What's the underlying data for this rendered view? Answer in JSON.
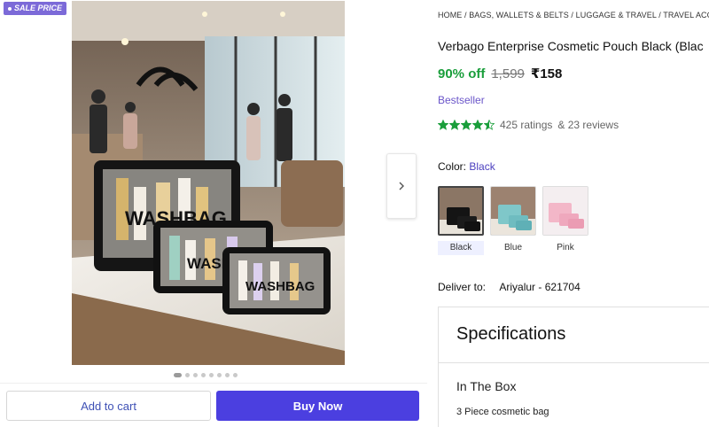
{
  "badge": {
    "label": "SALE PRICE"
  },
  "gallery": {
    "image_text": "WASHBAG",
    "dot_count": 8,
    "active_dot": 0
  },
  "actions": {
    "add_to_cart": "Add to cart",
    "buy_now": "Buy Now"
  },
  "product": {
    "breadcrumb": "HOME / BAGS, WALLETS & BELTS / LUGGAGE & TRAVEL / TRAVEL ACCESSO",
    "title": "Verbago Enterprise Cosmetic Pouch Black (Blac",
    "discount": "90% off",
    "mrp": "1,599",
    "price": "₹158",
    "tag": "Bestseller",
    "rating_value": 4.5,
    "ratings_text": "425 ratings",
    "reviews_text": "& 23 reviews",
    "color_label": "Color:",
    "color_value": "Black",
    "colors": [
      {
        "label": "Black",
        "selected": true
      },
      {
        "label": "Blue",
        "selected": false
      },
      {
        "label": "Pink",
        "selected": false
      }
    ],
    "deliver_label": "Deliver to:",
    "deliver_location": "Ariyalur - 621704"
  },
  "specifications": {
    "title": "Specifications",
    "section": "In The Box",
    "value": "3 Piece cosmetic bag"
  },
  "colors": {
    "accent": "#4b3fe0",
    "discount_green": "#1a9e3b",
    "badge_purple": "#7c6ad8",
    "star_green": "#1a9e3b"
  }
}
